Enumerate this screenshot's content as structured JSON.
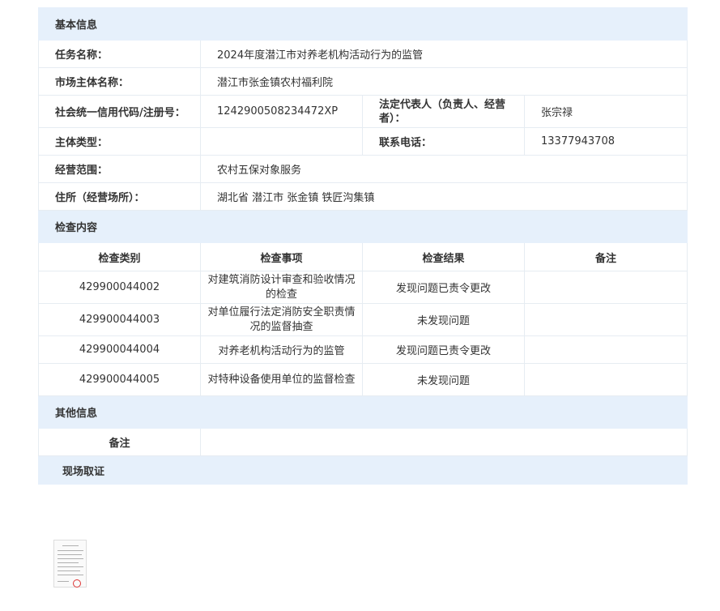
{
  "sections": {
    "basic": "基本信息",
    "inspection": "检查内容",
    "other": "其他信息",
    "evidence": "现场取证"
  },
  "basic": {
    "task_label": "任务名称：",
    "task_value": "2024年度潜江市对养老机构活动行为的监管",
    "entity_label": "市场主体名称：",
    "entity_value": "潜江市张金镇农村福利院",
    "credit_label": "社会统一信用代码/注册号：",
    "credit_value": "12429005082344​72XP",
    "rep_label": "法定代表人（负责人、经营者）：",
    "rep_value": "张宗禄",
    "type_label": "主体类型：",
    "type_value": "",
    "phone_label": "联系电话：",
    "phone_value": "13377943708",
    "scope_label": "经营范围：",
    "scope_value": "农村五保对象服务",
    "addr_label": "住所（经营场所）：",
    "addr_value": "湖北省 潜江市 张金镇 铁匠沟集镇"
  },
  "inspection": {
    "headers": [
      "检查类别",
      "检查事项",
      "检查结果",
      "备注"
    ],
    "rows": [
      {
        "category": "429900044002",
        "item": "对建筑消防设计审查和验收情况的检查",
        "result": "发现问题已责令更改",
        "note": ""
      },
      {
        "category": "429900044003",
        "item": "对单位履行法定消防安全职责情况的监督抽查",
        "result": "未发现问题",
        "note": ""
      },
      {
        "category": "429900044004",
        "item": "对养老机构活动行为的监管",
        "result": "发现问题已责令更改",
        "note": ""
      },
      {
        "category": "429900044005",
        "item": "对特种设备使用单位的监督检查",
        "result": "未发现问题",
        "note": ""
      }
    ]
  },
  "other": {
    "note_label": "备注",
    "note_value": ""
  }
}
